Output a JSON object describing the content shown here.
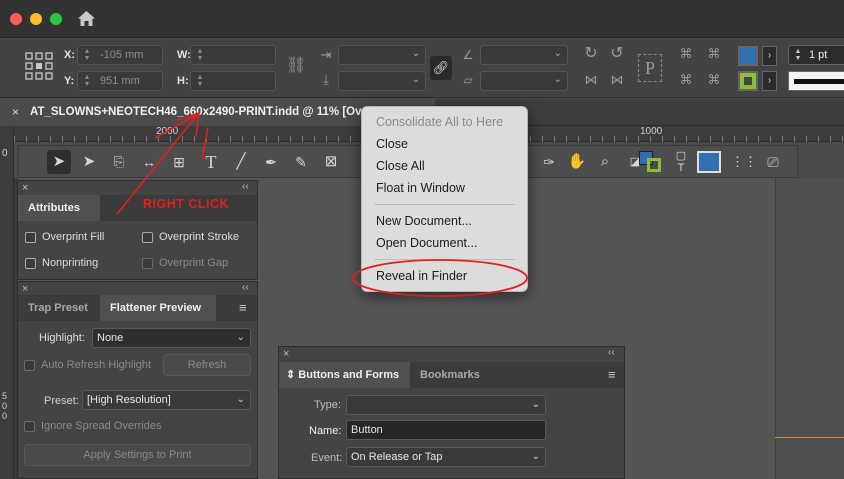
{
  "window": {
    "home_icon": "home-icon"
  },
  "control_panel": {
    "x_label": "X:",
    "x_value": "-105 mm",
    "y_label": "Y:",
    "y_value": "951 mm",
    "w_label": "W:",
    "h_label": "H:",
    "stroke_weight": "1 pt",
    "fill_color": "#2f6fb4",
    "stroke_color": "#8bbf33"
  },
  "document_tab": {
    "close_glyph": "×",
    "title": "AT_SLOWNS+NEOTECH46_660x2490-PRINT.indd @ 11% [Overpr"
  },
  "ruler": {
    "labels": [
      "2000",
      "1000"
    ],
    "vertical_labels": [
      "0",
      "5",
      "0",
      "0"
    ]
  },
  "attributes_panel": {
    "tab": "Attributes",
    "overprint_fill": "Overprint Fill",
    "overprint_stroke": "Overprint Stroke",
    "nonprinting": "Nonprinting",
    "overprint_gap": "Overprint Gap"
  },
  "flattener_panel": {
    "tab_trap": "Trap Preset",
    "tab_flattener": "Flattener Preview",
    "highlight_label": "Highlight:",
    "highlight_value": "None",
    "auto_refresh": "Auto Refresh Highlight",
    "refresh_button": "Refresh",
    "preset_label": "Preset:",
    "preset_value": "[High Resolution]",
    "ignore_spread": "Ignore Spread Overrides",
    "apply_button": "Apply Settings to Print"
  },
  "buttons_panel": {
    "tab_buttons": "Buttons and Forms",
    "tab_bookmarks": "Bookmarks",
    "type_label": "Type:",
    "type_value": "",
    "name_label": "Name:",
    "name_value": "Button",
    "event_label": "Event:",
    "event_value": "On Release or Tap"
  },
  "context_menu": {
    "items": [
      {
        "label": "Consolidate All to Here",
        "enabled": false
      },
      {
        "label": "Close",
        "enabled": true
      },
      {
        "label": "Close All",
        "enabled": true
      },
      {
        "label": "Float in Window",
        "enabled": true
      },
      {
        "label": "New Document...",
        "enabled": true
      },
      {
        "label": "Open Document...",
        "enabled": true
      },
      {
        "label": "Reveal in Finder",
        "enabled": true
      }
    ]
  },
  "annotation": {
    "text": "RIGHT CLICK",
    "color": "#e0201b"
  }
}
